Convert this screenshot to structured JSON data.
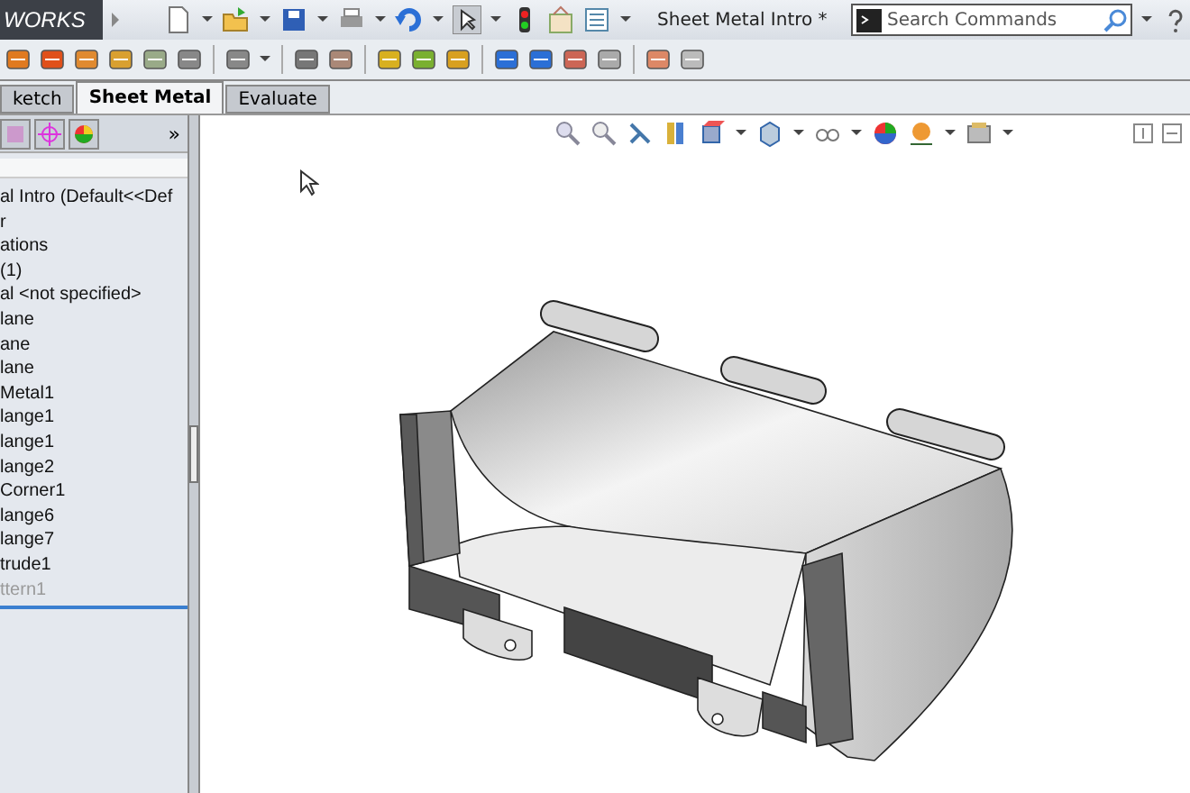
{
  "window": {
    "logo": "WORKS",
    "title": "Sheet Metal Intro *"
  },
  "search": {
    "placeholder": "Search Commands"
  },
  "tabs": [
    {
      "label": "ketch",
      "selected": false
    },
    {
      "label": "Sheet Metal",
      "selected": true
    },
    {
      "label": "Evaluate",
      "selected": false
    }
  ],
  "panel": {
    "more": "»"
  },
  "tree": [
    {
      "text": "al Intro  (Default<<Def",
      "rolled_back": false
    },
    {
      "text": "r",
      "rolled_back": false
    },
    {
      "text": "ations",
      "rolled_back": false
    },
    {
      "text": "(1)",
      "rolled_back": false
    },
    {
      "text": "al <not specified>",
      "rolled_back": false
    },
    {
      "text": "lane",
      "rolled_back": false
    },
    {
      "text": "ane",
      "rolled_back": false
    },
    {
      "text": "lane",
      "rolled_back": false
    },
    {
      "text": "Metal1",
      "rolled_back": false
    },
    {
      "text": "lange1",
      "rolled_back": false
    },
    {
      "text": "lange1",
      "rolled_back": false
    },
    {
      "text": "lange2",
      "rolled_back": false
    },
    {
      "text": "Corner1",
      "rolled_back": false
    },
    {
      "text": "lange6",
      "rolled_back": false
    },
    {
      "text": "lange7",
      "rolled_back": false
    },
    {
      "text": "trude1",
      "rolled_back": false
    },
    {
      "text": "ttern1",
      "rolled_back": true
    }
  ]
}
